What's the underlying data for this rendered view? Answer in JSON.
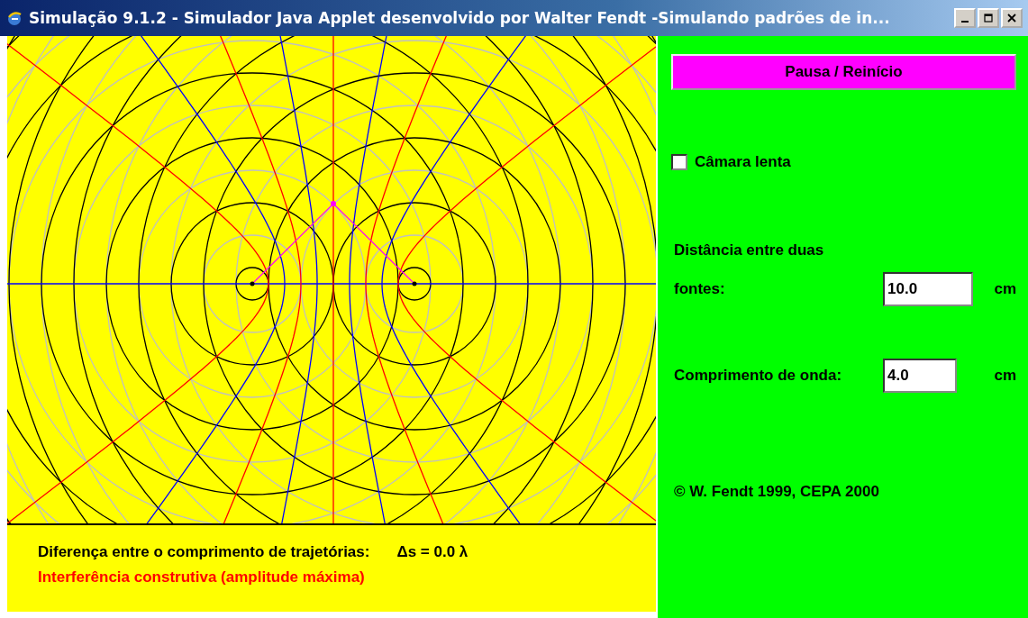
{
  "window": {
    "title": "Simulação 9.1.2 - Simulador Java Applet desenvolvido por Walter Fendt -Simulando padrões de in..."
  },
  "readout": {
    "label": "Diferença entre o comprimento de trajetórias:",
    "value": "Δs = 0.0 λ",
    "result": "Interferência construtiva (amplitude máxima)"
  },
  "controls": {
    "pause_button": "Pausa / Reinício",
    "slow_motion": {
      "label": "Câmara lenta",
      "checked": false
    },
    "distance": {
      "label": "Distância entre duas",
      "label_2": "fontes:",
      "value": "10.0",
      "unit": "cm"
    },
    "wavelength": {
      "label": "Comprimento de onda:",
      "value": "4.0",
      "unit": "cm"
    },
    "copyright": "© W. Fendt 1999, CEPA 2000"
  }
}
